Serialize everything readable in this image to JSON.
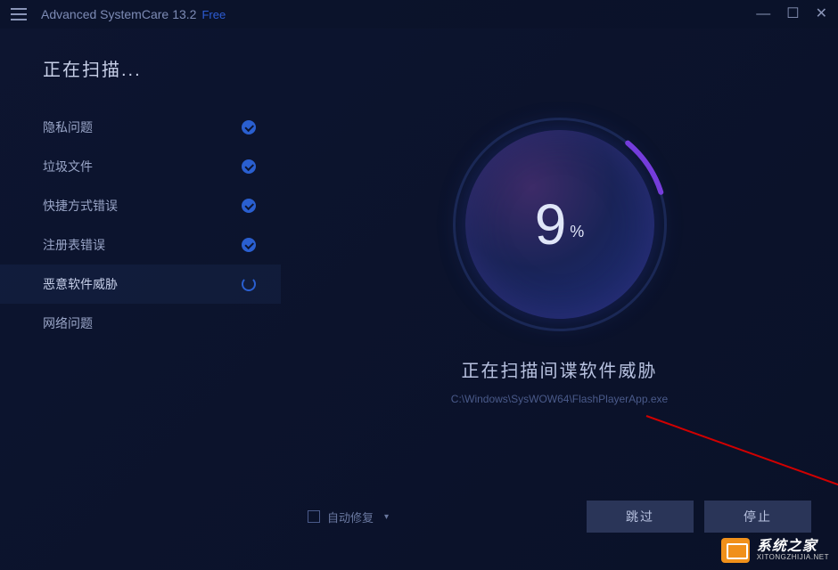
{
  "titlebar": {
    "app_name": "Advanced SystemCare",
    "version": "13.2",
    "edition": "Free"
  },
  "sidebar": {
    "title": "正在扫描...",
    "items": [
      {
        "label": "隐私问题",
        "status": "done"
      },
      {
        "label": "垃圾文件",
        "status": "done"
      },
      {
        "label": "快捷方式错误",
        "status": "done"
      },
      {
        "label": "注册表错误",
        "status": "done"
      },
      {
        "label": "恶意软件威胁",
        "status": "scanning"
      },
      {
        "label": "网络问题",
        "status": "pending"
      }
    ]
  },
  "progress": {
    "percent": "9",
    "percent_sign": "%",
    "arc_fraction": 0.09
  },
  "status": {
    "title": "正在扫描间谍软件威胁",
    "path": "C:\\Windows\\SysWOW64\\FlashPlayerApp.exe"
  },
  "bottom": {
    "auto_fix_label": "自动修复",
    "skip_label": "跳过",
    "stop_label": "停止"
  },
  "watermark": {
    "cn": "系统之家",
    "en": "XITONGZHIJIA.NET"
  },
  "colors": {
    "accent": "#2a5fd0",
    "ring_progress_start": "#a04de0",
    "ring_progress_end": "#7a3de0"
  }
}
